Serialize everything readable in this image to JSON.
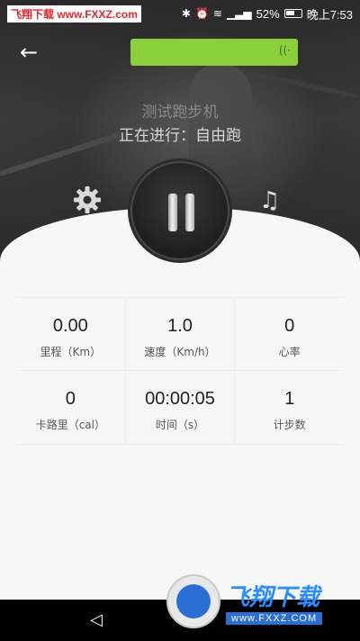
{
  "status_bar": {
    "watermark": "飞翔下载 www.FXXZ.com",
    "battery": "52%",
    "time": "晚上7:53"
  },
  "header": {
    "back_icon": "arrow-left-icon",
    "device_status_icon": "wifi-icon"
  },
  "hero": {
    "title": "测试跑步机",
    "subtitle": "正在进行：自由跑"
  },
  "controls": {
    "settings_icon": "gear-icon",
    "pause_icon": "pause-icon",
    "music_icon": "music-note-icon"
  },
  "stats": [
    [
      {
        "value": "0.00",
        "label": "里程（Km）"
      },
      {
        "value": "1.0",
        "label": "速度（Km/h）"
      },
      {
        "value": "0",
        "label": "心率"
      }
    ],
    [
      {
        "value": "0",
        "label": "卡路里（cal）"
      },
      {
        "value": "00:00:05",
        "label": "时间（s）"
      },
      {
        "value": "1",
        "label": "计步数"
      }
    ]
  ],
  "watermark_bottom": {
    "brand": "飞翔下载",
    "url": "www.FXXZ.COM"
  },
  "colors": {
    "accent_green": "#8bd03a",
    "watermark_red": "#e0262a",
    "watermark_blue": "#2a6fd1"
  }
}
